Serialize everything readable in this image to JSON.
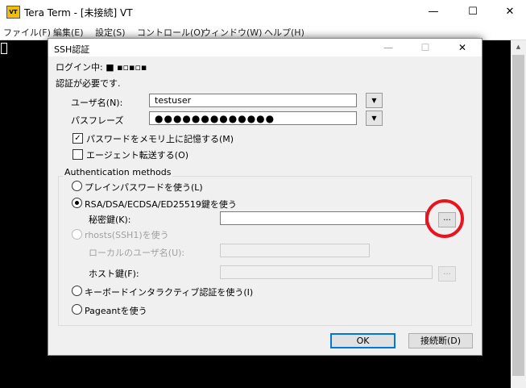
{
  "window": {
    "icon_text": "VT",
    "title": "Tera Term - [未接続] VT",
    "minimize": "—",
    "maximize": "☐",
    "close": "✕"
  },
  "menu": [
    "ファイル(F)",
    "編集(E)",
    "設定(S)",
    "コントロール(O)",
    "ウィンドウ(W)",
    "ヘルプ(H)"
  ],
  "dialog": {
    "title": "SSH認証",
    "title_minimize": "—",
    "title_maximize": "☐",
    "title_close": "✕",
    "login_line": "ログイン中: ■ ▪▫▪▫▪",
    "auth_required": "認証が必要です.",
    "username_label": "ユーザ名(N):",
    "username_value": "testuser",
    "passphrase_label": "パスフレーズ",
    "passphrase_value": "●●●●●●●●●●●●●",
    "dropdown_arrow": "▼",
    "remember_password": {
      "label": "パスワードをメモリ上に記憶する(M)",
      "checked": true,
      "mark": "✓"
    },
    "agent_forward": {
      "label": "エージェント転送する(O)",
      "checked": false
    },
    "auth_methods_label": "Authentication methods",
    "methods": {
      "plain": "プレインパスワードを使う(L)",
      "rsa": "RSA/DSA/ECDSA/ED25519鍵を使う",
      "rhosts": "rhosts(SSH1)を使う",
      "keyboard": "キーボードインタラクティブ認証を使う(I)",
      "pageant": "Pageantを使う"
    },
    "selected_method": "rsa",
    "private_key_label": "秘密鍵(K):",
    "private_key_value": "",
    "local_user_label": "ローカルのユーザ名(U):",
    "local_user_value": "",
    "host_key_label": "ホスト鍵(F):",
    "host_key_value": "",
    "browse_label": "...",
    "ok_label": "OK",
    "disconnect_label": "接続断(D)"
  },
  "annotation": {
    "color": "#e8141e"
  }
}
